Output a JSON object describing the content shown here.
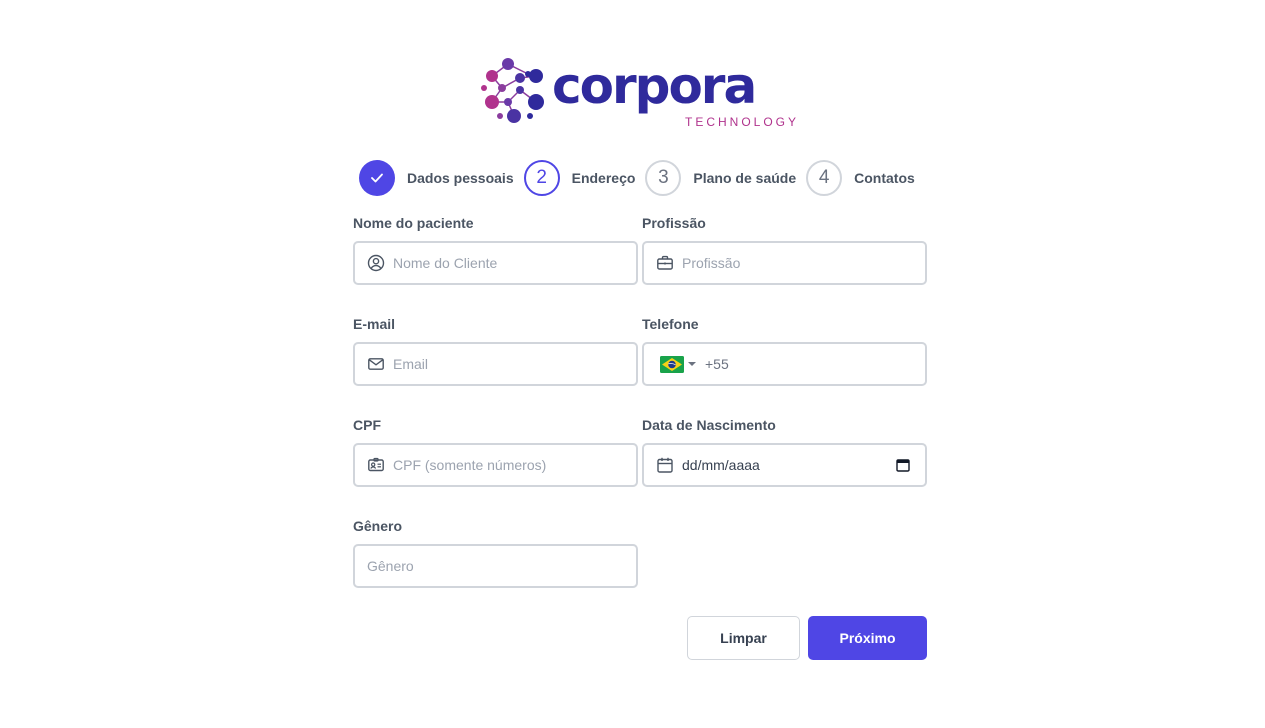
{
  "brand": {
    "name": "corpora",
    "tagline": "TECHNOLOGY",
    "colors": {
      "primary": "#2f2a9c",
      "accent": "#b0338d"
    }
  },
  "stepper": {
    "steps": [
      {
        "number": "",
        "label": "Dados pessoais",
        "state": "done",
        "icon": "check-icon"
      },
      {
        "number": "2",
        "label": "Endereço",
        "state": "active"
      },
      {
        "number": "3",
        "label": "Plano de saúde",
        "state": "idle"
      },
      {
        "number": "4",
        "label": "Contatos",
        "state": "idle"
      }
    ]
  },
  "form": {
    "patient_name": {
      "label": "Nome do paciente",
      "placeholder": "Nome do Cliente",
      "value": "",
      "icon": "user-circle-icon"
    },
    "profession": {
      "label": "Profissão",
      "placeholder": "Profissão",
      "value": "",
      "icon": "briefcase-icon"
    },
    "email": {
      "label": "E-mail",
      "placeholder": "Email",
      "value": "",
      "icon": "mail-icon"
    },
    "phone": {
      "label": "Telefone",
      "country_flag": "brazil-flag-icon",
      "value": "+55"
    },
    "cpf": {
      "label": "CPF",
      "placeholder": "CPF (somente números)",
      "value": "",
      "icon": "id-card-icon"
    },
    "birth_date": {
      "label": "Data de Nascimento",
      "value": "dd/mm/aaaa",
      "icon": "calendar-icon"
    },
    "gender": {
      "label": "Gênero",
      "placeholder": "Gênero",
      "value": ""
    }
  },
  "actions": {
    "clear_label": "Limpar",
    "next_label": "Próximo",
    "primary_color": "#4f46e5"
  }
}
